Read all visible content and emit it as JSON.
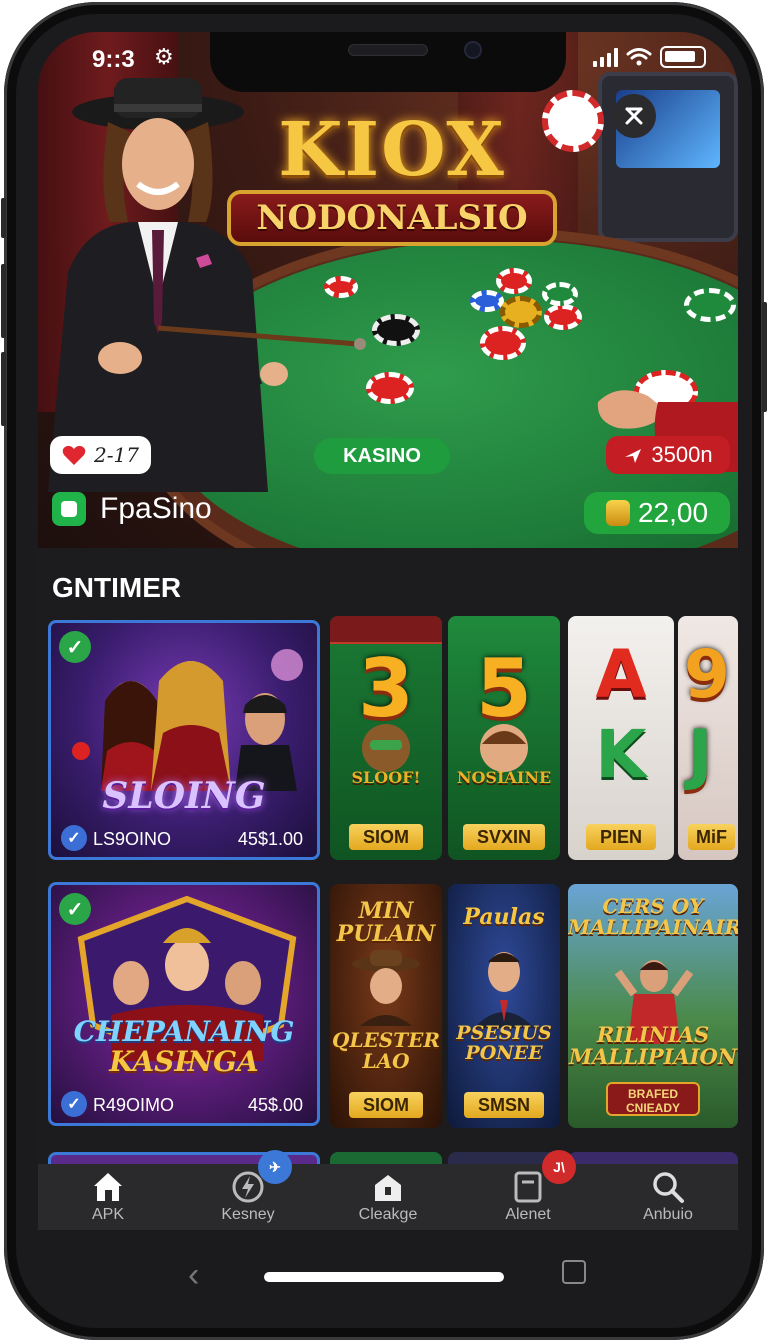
{
  "status_bar": {
    "time": "9::3"
  },
  "hero": {
    "logo_top": "KIOX",
    "logo_ribbon": "NODONALSIO",
    "likes": "2-17",
    "center_badge": "KASINO",
    "price": "3500n",
    "brand_name": "FpaSino",
    "balance": "22,00"
  },
  "section": {
    "title": "GNTIMER"
  },
  "row1": {
    "feature": {
      "title": "SLOING",
      "label": "LS9OINO",
      "amount": "45$1.00"
    },
    "slots": [
      {
        "symbol": "3",
        "caption": "SLOOF!",
        "button": "SIOM",
        "bg": "#1f8a3c"
      },
      {
        "symbol": "5",
        "caption": "NOSIAINE",
        "button": "SVXIN",
        "bg": "#1d7d36"
      },
      {
        "symbol_top": "A",
        "symbol_mid": "K",
        "button": "PIEN",
        "bg": "#e8e6e3"
      },
      {
        "symbol_top": "9",
        "symbol_mid": "J",
        "button": "MiF",
        "bg": "#e6dedc"
      }
    ]
  },
  "row2": {
    "feature": {
      "title_line1": "CHEPANAING",
      "title_line2": "KASINGA",
      "label": "R49OIMO",
      "amount": "45$.00"
    },
    "posters": [
      {
        "title_top": "MIN PULAIN",
        "title_bottom": "QLESTER LAO",
        "button": "SIOM"
      },
      {
        "title_top": "Paulas",
        "title_bottom": "PSESIUS PONEE",
        "button": "SMSN"
      },
      {
        "title_top": "CERS OY MALLIPAINAIR",
        "title_bottom": "RILINIAS MALLIPIAION",
        "sub": "BRAFED CNIEADY"
      }
    ]
  },
  "nav": [
    {
      "label": "APK",
      "icon": "home-icon"
    },
    {
      "label": "Kesney",
      "icon": "bolt-icon"
    },
    {
      "label": "Cleakge",
      "icon": "house-icon"
    },
    {
      "label": "Alenet",
      "icon": "note-icon",
      "badge": "J\\"
    },
    {
      "label": "Anbuio",
      "icon": "search-icon"
    }
  ],
  "colors": {
    "accent_green": "#22a53d",
    "accent_red": "#c51d24",
    "accent_blue": "#3b78d8",
    "background": "#1c1c1e"
  }
}
